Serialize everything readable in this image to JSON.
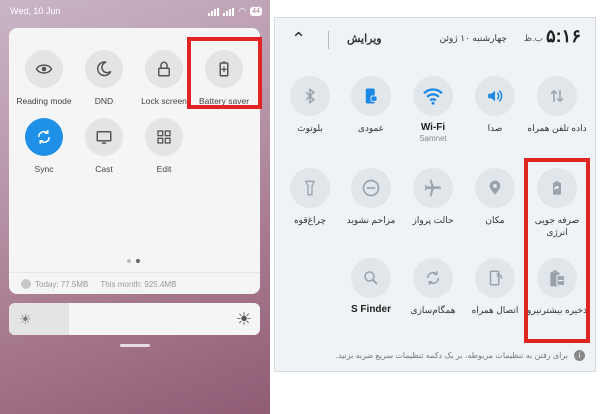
{
  "left": {
    "status": {
      "time": "Wed, 10 Jun",
      "battery": "44"
    },
    "tiles": [
      {
        "label": "Reading mode",
        "icon": "eye-icon"
      },
      {
        "label": "DND",
        "icon": "moon-icon"
      },
      {
        "label": "Lock screen",
        "icon": "lock-icon"
      },
      {
        "label": "Battery saver",
        "icon": "battery-plus-icon"
      },
      {
        "label": "Sync",
        "icon": "sync-icon",
        "active": true
      },
      {
        "label": "Cast",
        "icon": "monitor-icon"
      },
      {
        "label": "Edit",
        "icon": "grid-icon"
      }
    ],
    "data_usage": {
      "today": "Today: 77.5MB",
      "month": "This month: 925.4MB"
    },
    "brightness": {
      "level": 0.24
    },
    "accent": "#1e90e8",
    "highlight_color": "#e02424"
  },
  "right": {
    "header": {
      "edit": "ویرایش",
      "time": "۵:۱۶",
      "ampm": "ب.ظ",
      "date": "چهارشنبه ۱۰ ژوئن"
    },
    "tiles": [
      {
        "label": "بلوتوث",
        "icon": "bluetooth-icon"
      },
      {
        "label": "عمودی",
        "icon": "portrait-lock-icon"
      },
      {
        "label": "Wi-Fi",
        "sub": "Samnet",
        "icon": "wifi-icon"
      },
      {
        "label": "صدا",
        "icon": "volume-icon"
      },
      {
        "label": "داده تلفن همراه",
        "icon": "mobile-data-icon"
      },
      {
        "label": "چراغ‌قوه",
        "icon": "flashlight-icon"
      },
      {
        "label": "مزاحم نشوید",
        "icon": "dnd-icon"
      },
      {
        "label": "حالت پرواز",
        "icon": "airplane-icon"
      },
      {
        "label": "مکان",
        "icon": "location-icon"
      },
      {
        "label": "صرفه جویی انرژی",
        "icon": "battery-saver-icon"
      },
      {
        "label": "S Finder",
        "icon": "search-icon"
      },
      {
        "label": "همگام‌سازی",
        "icon": "sync-icon"
      },
      {
        "label": "اتصال همراه",
        "icon": "mobile-hotspot-icon"
      },
      {
        "label": "ذخیره بیشترنیرو",
        "icon": "max-power-saving-icon"
      }
    ],
    "footer": "برای رفتن به تنظیمات مربوطه، بر یک دکمه تنظیمات سریع ضربه بزنید."
  }
}
